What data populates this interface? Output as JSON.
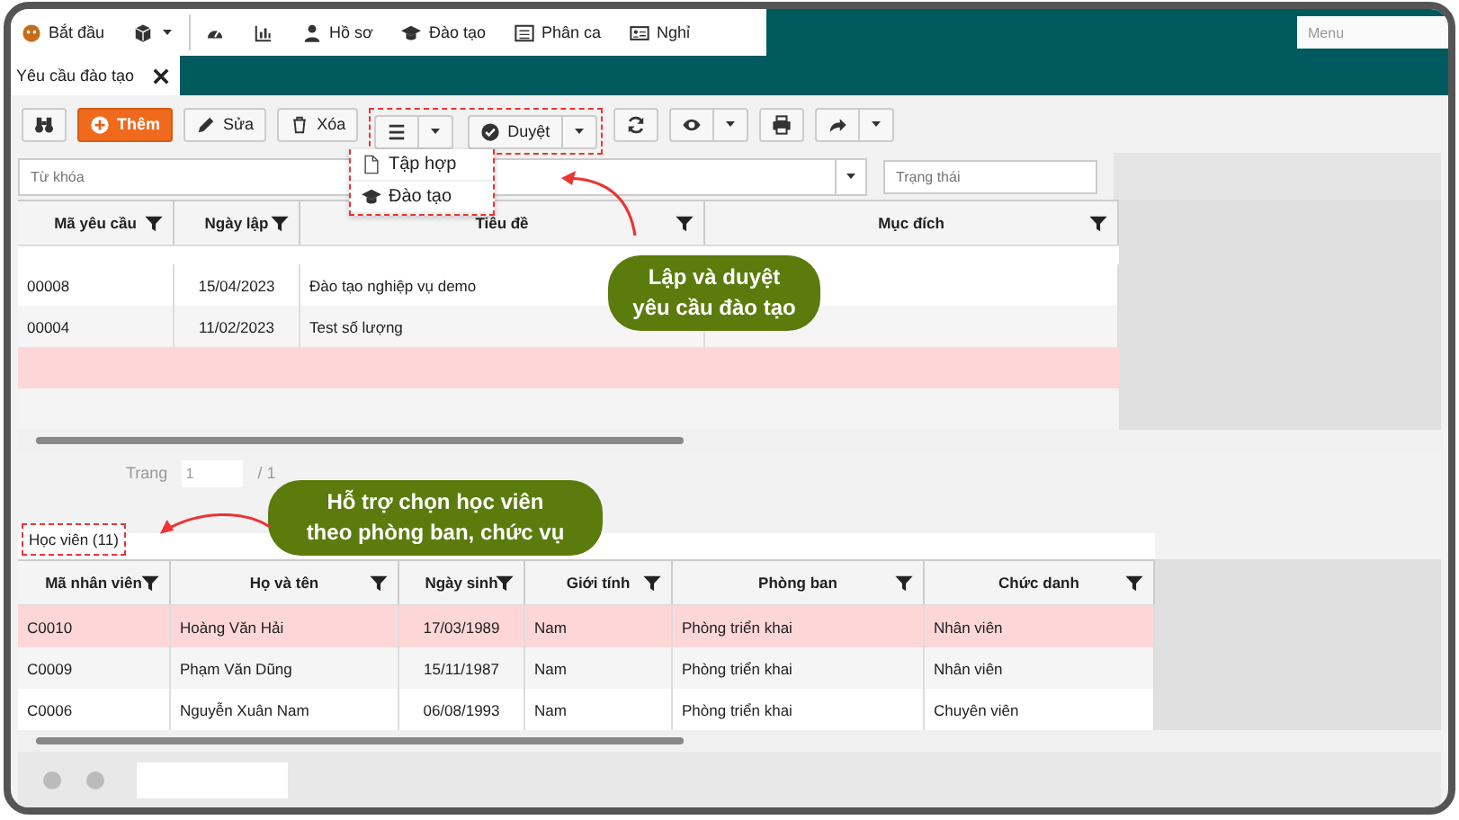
{
  "nav": {
    "items": [
      {
        "kind": "labeled",
        "label": "Bắt đầu"
      },
      {
        "kind": "dropdown"
      },
      {
        "kind": "icon"
      },
      {
        "kind": "icon"
      },
      {
        "kind": "labeled",
        "label": "Hồ sơ"
      },
      {
        "kind": "labeled",
        "label": "Đào tạo"
      },
      {
        "kind": "labeled",
        "label": "Phân ca"
      },
      {
        "kind": "labeled",
        "label": "Nghỉ"
      }
    ],
    "menu_placeholder": "Menu"
  },
  "open_tabs": [
    {
      "label": "Yêu cầu đào tạo",
      "selected": true
    }
  ],
  "toolbar": [
    {
      "kind": "icon"
    },
    {
      "kind": "primary",
      "label": "Thêm"
    },
    {
      "kind": "text",
      "label": "Sửa"
    },
    {
      "kind": "text",
      "label": "Xóa"
    },
    {
      "kind": "split"
    },
    {
      "kind": "split",
      "label": "Duyệt"
    },
    {
      "kind": "icon"
    },
    {
      "kind": "split"
    },
    {
      "kind": "icon"
    },
    {
      "kind": "split"
    }
  ],
  "dropdown": {
    "items": [
      {
        "label": "Tập hợp"
      },
      {
        "label": "Đào tạo"
      }
    ]
  },
  "filters": {
    "keyword_placeholder": "Từ khóa",
    "status_placeholder": "Trạng thái"
  },
  "requests_table": {
    "columns": [
      "Mã yêu cầu",
      "Ngày lập",
      "Tiêu đề",
      "Mục đích"
    ],
    "rows": [
      {
        "cells": [
          "00008",
          "15/04/2023",
          "Đào tạo nghiệp vụ demo"
        ],
        "highlighted": false
      },
      {
        "cells": [
          "00004",
          "11/02/2023",
          "Test số lượng"
        ],
        "highlighted": false
      }
    ],
    "blurred_rows": [
      {
        "highlighted": true
      },
      {
        "highlighted": false
      }
    ]
  },
  "pager": {
    "label": "Trang",
    "page": "1",
    "total": "/ 1"
  },
  "callouts": [
    {
      "text": "Lập và duyệt yêu cầu đào tạo"
    },
    {
      "text": "Hỗ trợ chọn học viên theo phòng ban, chức vụ"
    }
  ],
  "lower_tab": {
    "label": "Học viên (11)",
    "selected": true
  },
  "students_table": {
    "columns": [
      "Mã nhân viên",
      "Họ và tên",
      "Ngày sinh",
      "Giới tính",
      "Phòng ban",
      "Chức danh"
    ],
    "rows": [
      {
        "cells": [
          "C0010",
          "Hoàng Văn Hải",
          "17/03/1989",
          "Nam",
          "Phòng triển khai",
          "Nhân viên"
        ],
        "highlighted": true
      },
      {
        "cells": [
          "C0009",
          "Phạm Văn Dũng",
          "15/11/1987",
          "Nam",
          "Phòng triển khai",
          "Nhân viên"
        ],
        "highlighted": false
      },
      {
        "cells": [
          "C0006",
          "Nguyễn Xuân Nam",
          "06/08/1993",
          "Nam",
          "Phòng triển khai",
          "Chuyên viên"
        ],
        "highlighted": false
      }
    ]
  }
}
